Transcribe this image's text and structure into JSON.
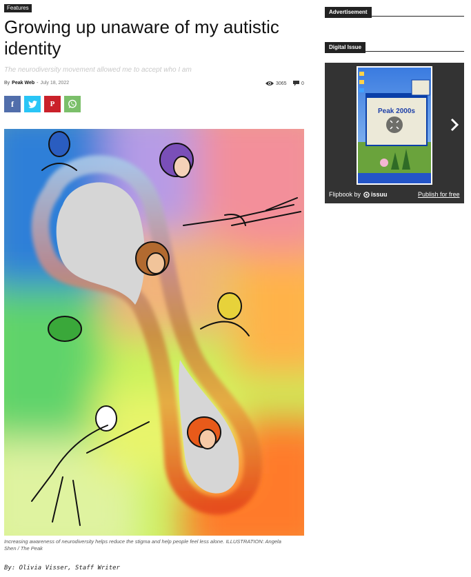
{
  "article": {
    "category": "Features",
    "title": "Growing up unaware of my autistic identity",
    "subtitle": "The neurodiversity movement allowed me to accept who I am",
    "by_prefix": "By",
    "author": "Peak Web",
    "separator": "-",
    "date": "July 18, 2022",
    "views": "3065",
    "comments": "0",
    "caption": "Increasing awareness of neurodiversity helps reduce the stigma and help people feel less alone. ILLUSTRATION: Angela Shen / The Peak",
    "byline": "By: Olivia Visser, Staff Writer"
  },
  "share": {
    "facebook_icon": "f",
    "twitter_icon": "twitter-bird",
    "pinterest_icon": "P",
    "whatsapp_icon": "whatsapp"
  },
  "sidebar": {
    "advertisement_title": "Advertisement",
    "digital_issue_title": "Digital Issue",
    "magazine_title": "Peak 2000s",
    "flipbook_prefix": "Flipbook by",
    "issuu_brand": "issuu",
    "publish_link": "Publish for free"
  },
  "colors": {
    "facebook": "#516eab",
    "twitter": "#29c5f6",
    "pinterest": "#ca212a",
    "whatsapp": "#7bbf6a",
    "tag_bg": "#222222"
  }
}
